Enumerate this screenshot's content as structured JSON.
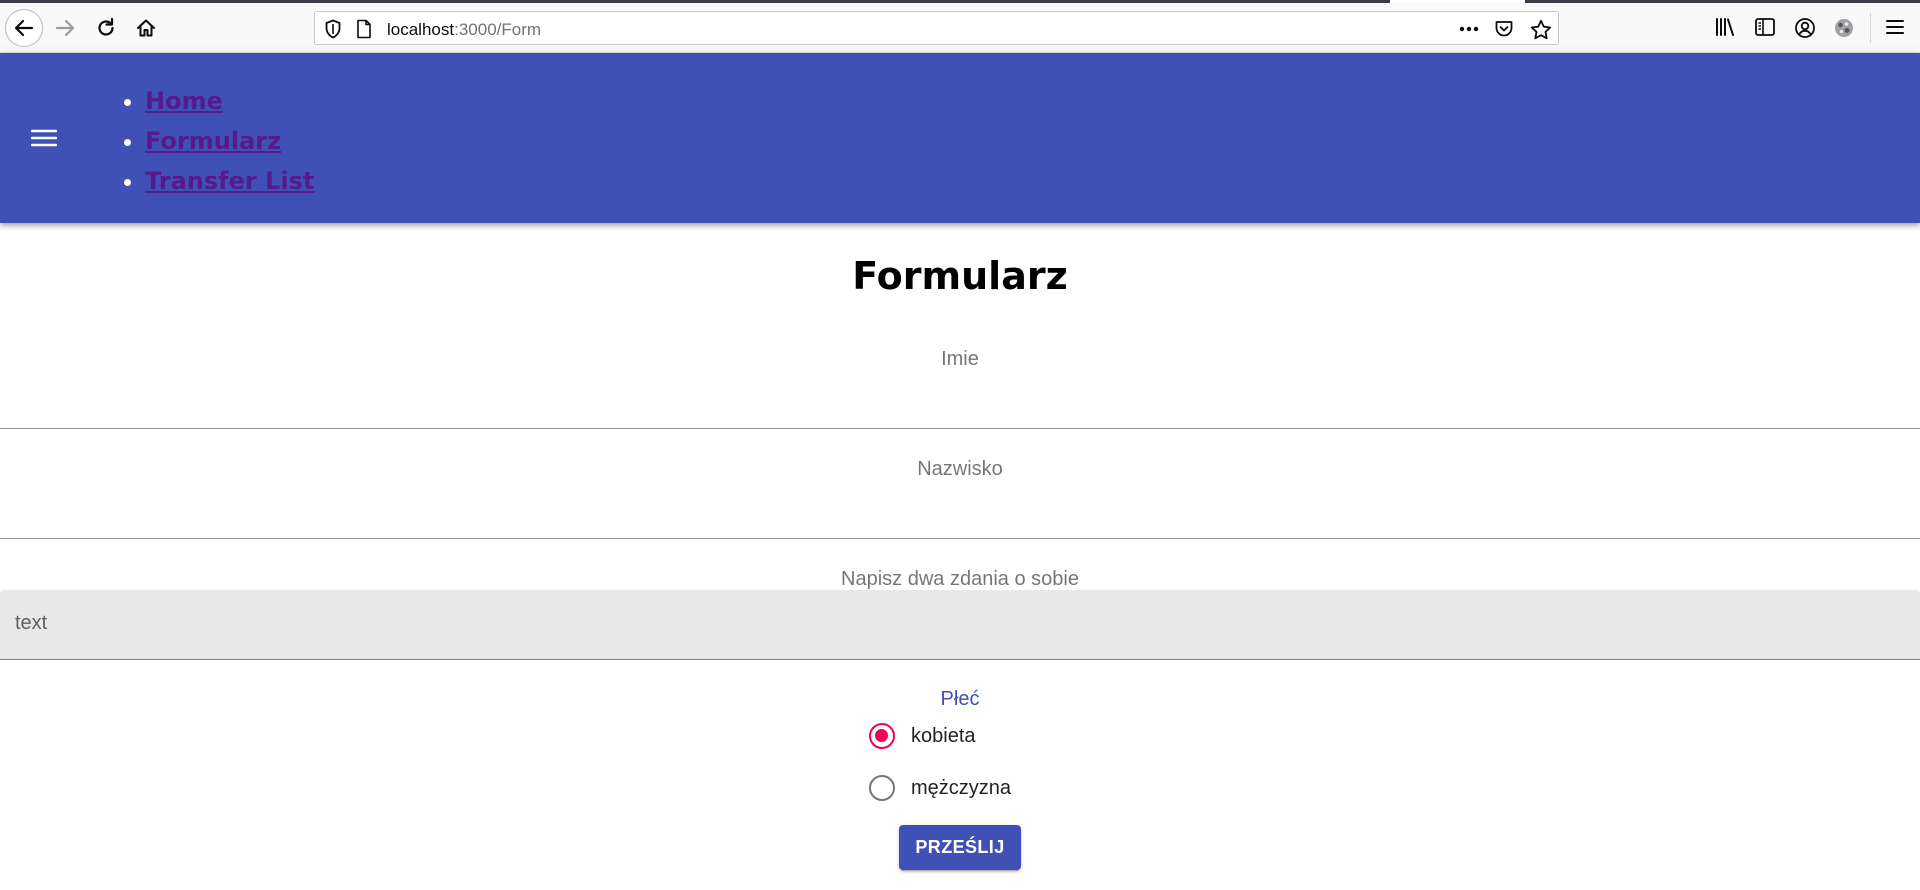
{
  "browser": {
    "url_host": "localhost",
    "url_path": ":3000/Form",
    "icons": {
      "back": "arrow-left-icon",
      "forward": "arrow-right-icon",
      "reload": "reload-icon",
      "home": "home-icon",
      "tracking": "shield-icon",
      "page": "page-icon",
      "page_actions": "more-horizontal-icon",
      "pocket": "pocket-icon",
      "bookmark": "star-icon",
      "library": "library-icon",
      "sidebar": "sidebar-icon",
      "account": "account-icon",
      "extension": "extension-icon",
      "menu": "hamburger-icon"
    }
  },
  "appbar": {
    "color": "#3f51b5",
    "menu_icon": "hamburger-icon",
    "nav": [
      {
        "label": "Home"
      },
      {
        "label": "Formularz"
      },
      {
        "label": "Transfer List"
      }
    ]
  },
  "form": {
    "title": "Formularz",
    "first_name": {
      "label": "Imie",
      "value": ""
    },
    "last_name": {
      "label": "Nazwisko",
      "value": ""
    },
    "about": {
      "label": "Napisz dwa zdania o sobie",
      "value": "text"
    },
    "gender": {
      "legend": "Płeć",
      "options": [
        {
          "label": "kobieta",
          "checked": true
        },
        {
          "label": "mężczyzna",
          "checked": false
        }
      ]
    },
    "submit_label": "PRZEŚLIJ",
    "accent_color": "#f50057"
  }
}
